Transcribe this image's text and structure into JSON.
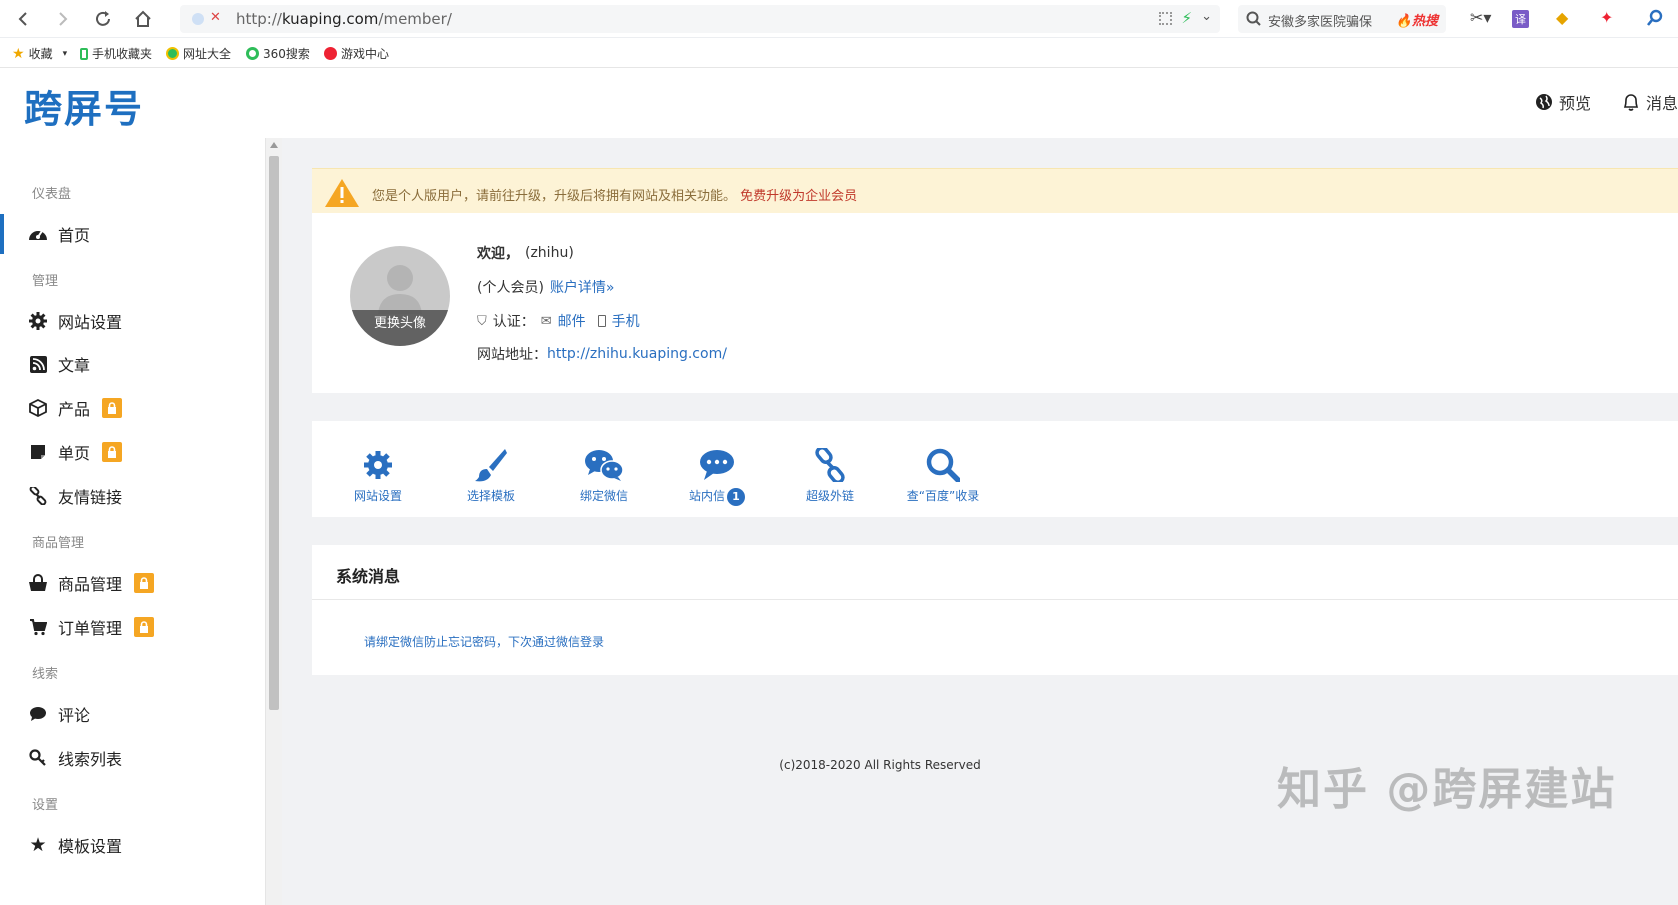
{
  "browser": {
    "url_prefix": "http://",
    "url_host": "kuaping.com",
    "url_path": "/member/",
    "search_query": "安徽多家医院骗保",
    "search_hot": "热搜"
  },
  "bookmarks": [
    {
      "label": "收藏"
    },
    {
      "label": "手机收藏夹"
    },
    {
      "label": "网址大全"
    },
    {
      "label": "360搜索"
    },
    {
      "label": "游戏中心"
    }
  ],
  "header": {
    "logo": "跨屏号",
    "preview": "预览",
    "messages": "消息"
  },
  "sidebar": {
    "groups": {
      "dashboard": "仪表盘",
      "manage": "管理",
      "goods": "商品管理",
      "leads": "线索",
      "settings": "设置"
    },
    "items": {
      "home": "首页",
      "site_settings": "网站设置",
      "articles": "文章",
      "products": "产品",
      "single_page": "单页",
      "friend_links": "友情链接",
      "goods_manage": "商品管理",
      "orders": "订单管理",
      "comments": "评论",
      "leads_list": "线索列表",
      "template_settings": "模板设置"
    }
  },
  "notice": {
    "text": "您是个人版用户，请前往升级，升级后将拥有网站及相关功能。",
    "link": "免费升级为企业会员"
  },
  "profile": {
    "change_avatar": "更换头像",
    "welcome_label": "欢迎，",
    "username": "(zhihu)",
    "member_type": "(个人会员)",
    "account_link": "账户详情»",
    "verify_label": "认证：",
    "verify_email": "邮件",
    "verify_phone": "手机",
    "site_url_label": "网站地址：",
    "site_url": "http://zhihu.kuaping.com/"
  },
  "quick_actions": {
    "site_settings": "网站设置",
    "choose_template": "选择模板",
    "bind_wechat": "绑定微信",
    "inbox": "站内信",
    "inbox_count": "1",
    "backlinks": "超级外链",
    "baidu_index": "查“百度”收录"
  },
  "system_messages": {
    "title": "系统消息",
    "message": "请绑定微信防止忘记密码，下次通过微信登录"
  },
  "footer": "(c)2018-2020 All Rights Reserved",
  "watermark": "知乎 @跨屏建站",
  "colors": {
    "brand": "#1e6fc0",
    "link": "#2a6fc0",
    "lock": "#f5a623",
    "notice_bg": "#fdf3d6",
    "notice_link": "#c0392b"
  }
}
